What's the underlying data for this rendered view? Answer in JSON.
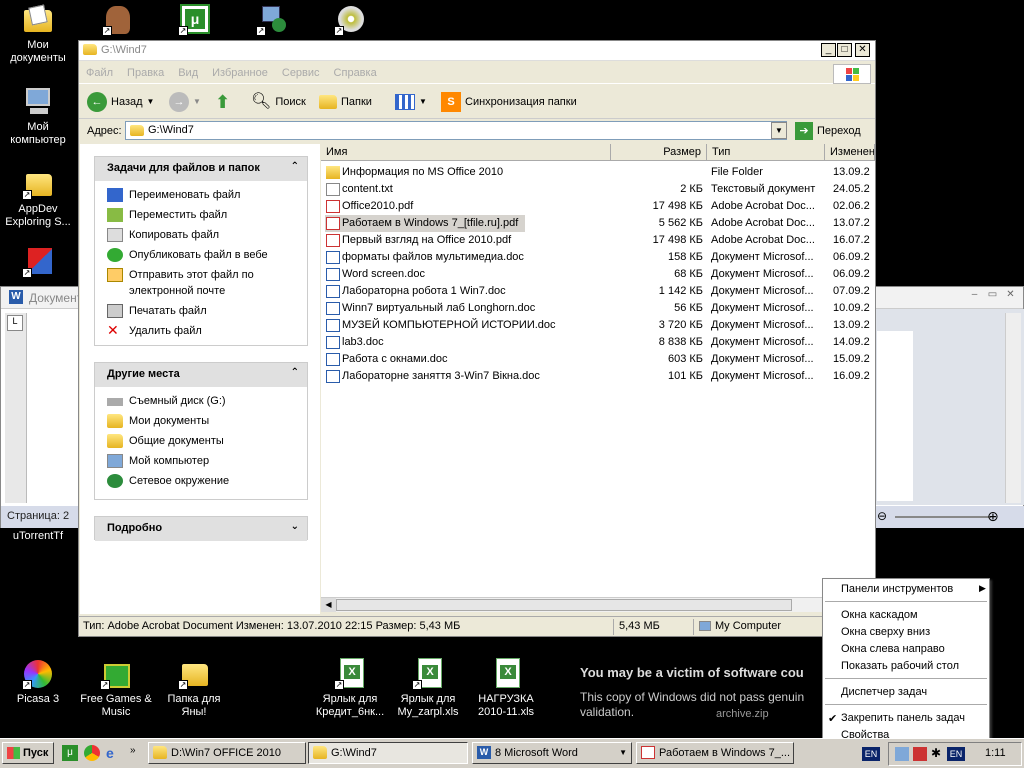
{
  "desktop": {
    "icons": [
      {
        "label": "Мои документы",
        "icon": "my-documents-icon"
      },
      {
        "label": "Мой компьютер",
        "icon": "my-computer-icon"
      },
      {
        "label": "AppDev Exploring S...",
        "icon": "folder-icon"
      },
      {
        "label": "uTorrentTf",
        "icon": "utorrent-icon"
      },
      {
        "label": "Picasa 3",
        "icon": "picasa-icon"
      },
      {
        "label": "Free Games & Music",
        "icon": "gift-icon"
      },
      {
        "label": "Папка для Яны!",
        "icon": "folder-icon"
      },
      {
        "label": "Ярлык для Кредит_6нк...",
        "icon": "excel-icon"
      },
      {
        "label": "Ярлык для My_zarpl.xls",
        "icon": "excel-icon"
      },
      {
        "label": "НАГРУЗКА 2010-11.xls",
        "icon": "excel-icon"
      }
    ]
  },
  "word": {
    "title": "Документ",
    "status": "Страница: 2"
  },
  "explorer": {
    "title": "G:\\Wind7",
    "menu": [
      "Файл",
      "Правка",
      "Вид",
      "Избранное",
      "Сервис",
      "Справка"
    ],
    "toolbar": {
      "back": "Назад",
      "search": "Поиск",
      "folders": "Папки",
      "sync": "Синхронизация папки"
    },
    "address": {
      "label": "Адрес:",
      "value": "G:\\Wind7",
      "go": "Переход"
    },
    "tasks": {
      "title": "Задачи для файлов и папок",
      "items": [
        "Переименовать файл",
        "Переместить файл",
        "Копировать файл",
        "Опубликовать файл в вебе",
        "Отправить этот файл по электронной почте",
        "Печатать файл",
        "Удалить файл"
      ]
    },
    "places": {
      "title": "Другие места",
      "items": [
        "Съемный диск (G:)",
        "Мои документы",
        "Общие документы",
        "Мой компьютер",
        "Сетевое окружение"
      ]
    },
    "details": {
      "title": "Подробно"
    },
    "columns": [
      "Имя",
      "Размер",
      "Тип",
      "Изменен"
    ],
    "files": [
      {
        "name": "Информация по MS Office 2010",
        "size": "",
        "type": "File Folder",
        "date": "13.09.2",
        "icon": "folder"
      },
      {
        "name": "content.txt",
        "size": "2 КБ",
        "type": "Текстовый документ",
        "date": "24.05.2",
        "icon": "txt"
      },
      {
        "name": "Office2010.pdf",
        "size": "17 498 КБ",
        "type": "Adobe Acrobat Doc...",
        "date": "02.06.2",
        "icon": "pdf"
      },
      {
        "name": "Работаем в Windows 7_[tfile.ru].pdf",
        "size": "5 562 КБ",
        "type": "Adobe Acrobat Doc...",
        "date": "13.07.2",
        "icon": "pdf"
      },
      {
        "name": "Первый взгляд на Office 2010.pdf",
        "size": "17 498 КБ",
        "type": "Adobe Acrobat Doc...",
        "date": "16.07.2",
        "icon": "pdf"
      },
      {
        "name": "форматы файлов мультимедиа.doc",
        "size": "158 КБ",
        "type": "Документ Microsof...",
        "date": "06.09.2",
        "icon": "doc"
      },
      {
        "name": "Word screen.doc",
        "size": "68 КБ",
        "type": "Документ Microsof...",
        "date": "06.09.2",
        "icon": "doc"
      },
      {
        "name": "Лабораторна робота 1 Win7.doc",
        "size": "1 142 КБ",
        "type": "Документ Microsof...",
        "date": "07.09.2",
        "icon": "doc"
      },
      {
        "name": "Winn7 виртуальный лаб Longhorn.doc",
        "size": "56 КБ",
        "type": "Документ Microsof...",
        "date": "10.09.2",
        "icon": "doc"
      },
      {
        "name": "МУЗЕЙ КОМПЬЮТЕРНОЙ ИСТОРИИ.doc",
        "size": "3 720 КБ",
        "type": "Документ Microsof...",
        "date": "13.09.2",
        "icon": "doc"
      },
      {
        "name": "lab3.doc",
        "size": "8 838 КБ",
        "type": "Документ Microsof...",
        "date": "14.09.2",
        "icon": "doc"
      },
      {
        "name": "Работа с окнами.doc",
        "size": "603 КБ",
        "type": "Документ Microsof...",
        "date": "15.09.2",
        "icon": "doc"
      },
      {
        "name": "Лабораторне заняття 3-Win7 Вікна.doc",
        "size": "101 КБ",
        "type": "Документ Microsof...",
        "date": "16.09.2",
        "icon": "doc"
      }
    ],
    "status": {
      "info": "Тип: Adobe Acrobat Document Изменен: 13.07.2010 22:15 Размер: 5,43 МБ",
      "size": "5,43 МБ",
      "location": "My Computer"
    }
  },
  "watermark": {
    "line1": "You may be a victim of software cou",
    "line2": "This copy of Windows did not pass genuin",
    "line3": "validation.",
    "archive": "archive.zip"
  },
  "context_menu": {
    "items": [
      {
        "label": "Панели инструментов",
        "submenu": true
      },
      {
        "label": "Окна каскадом"
      },
      {
        "label": "Окна сверху вниз"
      },
      {
        "label": "Окна слева направо"
      },
      {
        "label": "Показать рабочий стол"
      },
      {
        "label": "Диспетчер задач"
      },
      {
        "label": "Закрепить панель задач",
        "checked": true
      },
      {
        "label": "Свойства"
      }
    ]
  },
  "taskbar": {
    "start": "Пуск",
    "tasks": [
      "D:\\Win7 OFFICE 2010",
      "G:\\Wind7",
      "8 Microsoft Word",
      "Работаем в Windows 7_..."
    ],
    "lang": "EN",
    "lang2": "EN",
    "clock": "1:11"
  },
  "colors": {
    "desktop": "#000000",
    "selection": "#d6d3ce",
    "taskbar": "#d4d0c8"
  }
}
